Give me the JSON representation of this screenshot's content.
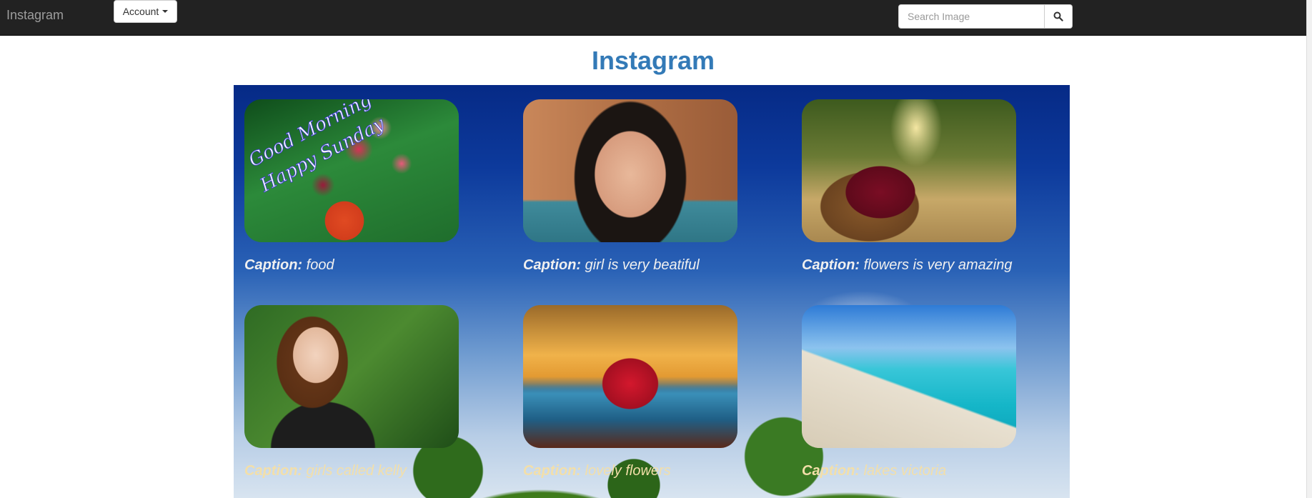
{
  "navbar": {
    "brand": "Instagram",
    "account_label": "Account",
    "search": {
      "placeholder": "Search Image",
      "value": ""
    },
    "icons": {
      "search": "search-icon",
      "account_caret": "caret-down-icon"
    }
  },
  "page": {
    "title": "Instagram"
  },
  "gallery": {
    "caption_label": "Caption:",
    "items": [
      {
        "caption": "food",
        "image": "good-morning-happy-sunday-flowers"
      },
      {
        "caption": "girl is very beatiful",
        "image": "portrait-girl"
      },
      {
        "caption": "flowers is very amazing",
        "image": "basket-of-roses"
      },
      {
        "caption": "girls called kelly",
        "image": "girl-in-park"
      },
      {
        "caption": "lovely flowers",
        "image": "red-lotus"
      },
      {
        "caption": "lakes victoria",
        "image": "tropical-beach"
      }
    ]
  },
  "colors": {
    "navbar": "#222222",
    "title": "#337ab7",
    "caption_text": "#f0f0f0"
  }
}
